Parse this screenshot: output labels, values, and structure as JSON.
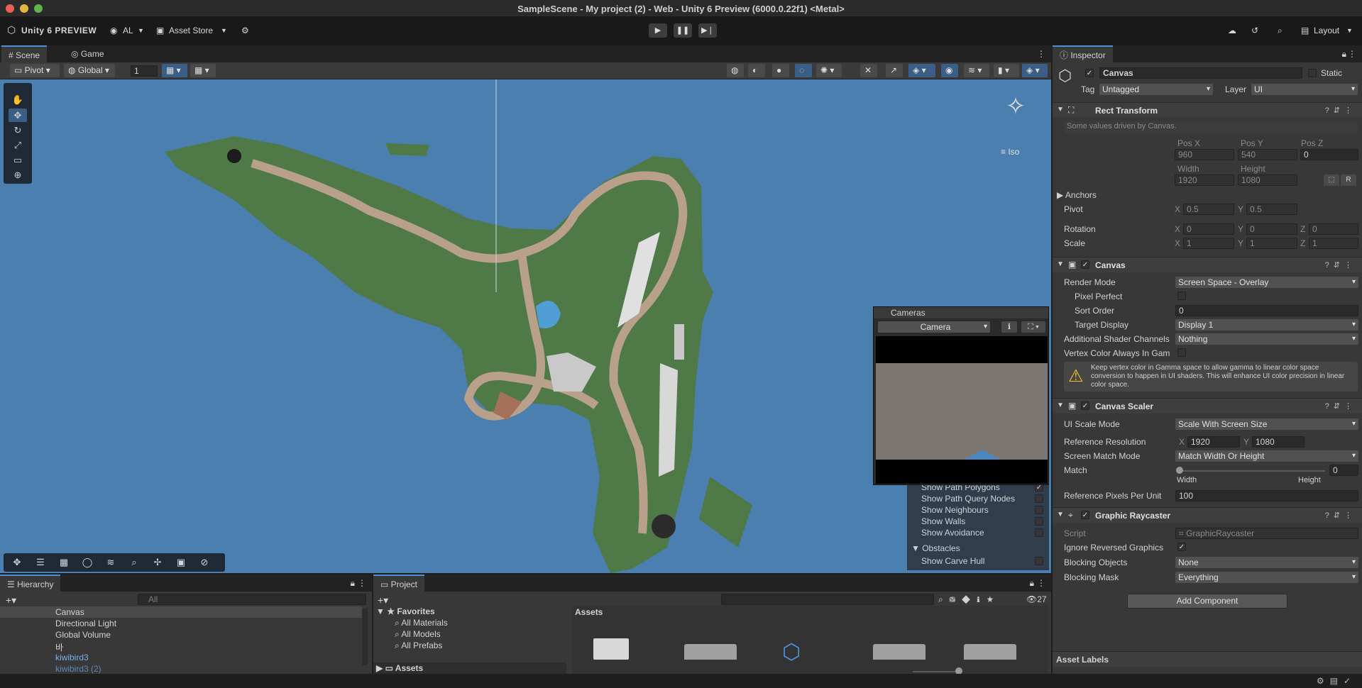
{
  "window": {
    "title": "SampleScene - My project (2) - Web - Unity 6 Preview (6000.0.22f1) <Metal>"
  },
  "toolbar": {
    "brand": "Unity 6 PREVIEW",
    "account": "AL",
    "asset_store": "Asset Store",
    "layout": "Layout"
  },
  "scene_tabs": {
    "scene": "Scene",
    "game": "Game"
  },
  "scene_toolbar": {
    "pivot": "Pivot",
    "global": "Global",
    "grid_snap": "1",
    "iso": "Iso"
  },
  "cameras": {
    "title": "Cameras",
    "camera": "Camera"
  },
  "navmesh_overlay": {
    "items": [
      {
        "label": "Show Path Polygons",
        "checked": true
      },
      {
        "label": "Show Path Query Nodes",
        "checked": false
      },
      {
        "label": "Show Neighbours",
        "checked": false
      },
      {
        "label": "Show Walls",
        "checked": false
      },
      {
        "label": "Show Avoidance",
        "checked": false
      }
    ],
    "obstacles": "Obstacles",
    "carve": "Show Carve Hull"
  },
  "inspector": {
    "tab": "Inspector",
    "object_name": "Canvas",
    "static": "Static",
    "tag_label": "Tag",
    "tag": "Untagged",
    "layer_label": "Layer",
    "layer": "UI",
    "rect": {
      "title": "Rect Transform",
      "note": "Some values driven by Canvas.",
      "posx_label": "Pos X",
      "posy_label": "Pos Y",
      "posz_label": "Pos Z",
      "posx": "960",
      "posy": "540",
      "posz": "0",
      "width_label": "Width",
      "height_label": "Height",
      "width": "1920",
      "height": "1080",
      "anchors": "Anchors",
      "pivot": "Pivot",
      "pivot_x": "0.5",
      "pivot_y": "0.5",
      "rotation": "Rotation",
      "rot_x": "0",
      "rot_y": "0",
      "rot_z": "0",
      "scale": "Scale",
      "scale_x": "1",
      "scale_y": "1",
      "scale_z": "1",
      "r_btn": "R"
    },
    "canvas": {
      "title": "Canvas",
      "render_mode_label": "Render Mode",
      "render_mode": "Screen Space - Overlay",
      "pixel_perfect": "Pixel Perfect",
      "sort_order_label": "Sort Order",
      "sort_order": "0",
      "target_display_label": "Target Display",
      "target_display": "Display 1",
      "shader_channels_label": "Additional Shader Channels",
      "shader_channels": "Nothing",
      "vertex_color": "Vertex Color Always In Gam",
      "warning": "Keep vertex color in Gamma space to allow gamma to linear color space conversion to happen in UI shaders. This will enhance UI color precision in linear color space."
    },
    "scaler": {
      "title": "Canvas Scaler",
      "ui_scale_label": "UI Scale Mode",
      "ui_scale": "Scale With Screen Size",
      "ref_res_label": "Reference Resolution",
      "ref_x": "1920",
      "ref_y": "1080",
      "match_mode_label": "Screen Match Mode",
      "match_mode": "Match Width Or Height",
      "match_label": "Match",
      "match": "0",
      "match_fraction": 0,
      "width": "Width",
      "height": "Height",
      "ppu_label": "Reference Pixels Per Unit",
      "ppu": "100"
    },
    "raycaster": {
      "title": "Graphic Raycaster",
      "script_label": "Script",
      "script": "GraphicRaycaster",
      "ignore_label": "Ignore Reversed Graphics",
      "blocking_objects_label": "Blocking Objects",
      "blocking_objects": "None",
      "blocking_mask_label": "Blocking Mask",
      "blocking_mask": "Everything"
    },
    "add_component": "Add Component",
    "asset_labels": "Asset Labels"
  },
  "hierarchy": {
    "tab": "Hierarchy",
    "search": "All",
    "items": [
      "Canvas",
      "Directional Light",
      "Global Volume",
      "바",
      "kiwibird3",
      "kiwibird3 (2)"
    ]
  },
  "project": {
    "tab": "Project",
    "favorites": "Favorites",
    "fav_items": [
      "All Materials",
      "All Models",
      "All Prefabs"
    ],
    "assets": "Assets",
    "assets_header": "Assets",
    "hidden_count": "27"
  },
  "colors": {
    "accent": "#4d90d8",
    "water": "#4a7fb0",
    "grass": "#4f7a48",
    "path": "#b8a08a"
  }
}
